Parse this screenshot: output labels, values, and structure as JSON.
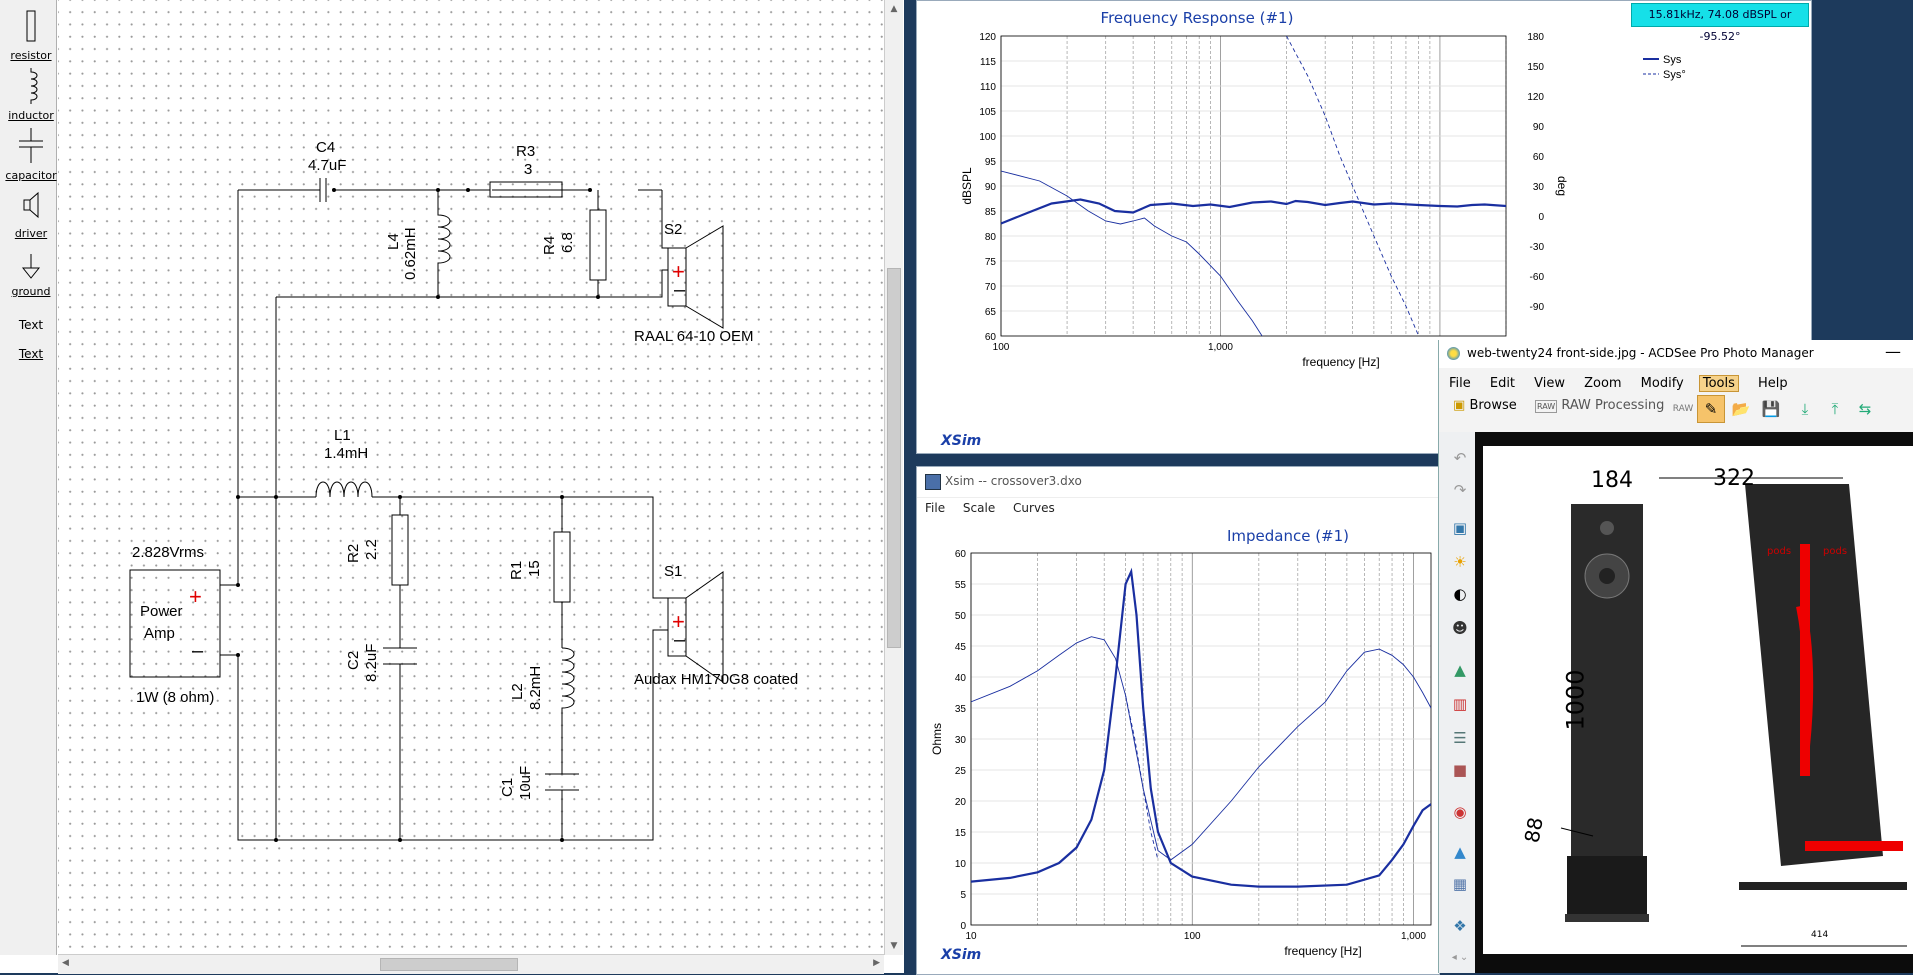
{
  "palette": {
    "items": [
      {
        "label": "resistor",
        "icon": "resistor-icon"
      },
      {
        "label": "inductor",
        "icon": "inductor-icon"
      },
      {
        "label": "capacitor",
        "icon": "capacitor-icon"
      },
      {
        "label": "driver",
        "icon": "driver-icon"
      },
      {
        "label": "ground",
        "icon": "ground-icon"
      },
      {
        "label": "Text",
        "icon": "text-icon"
      },
      {
        "label": "Text",
        "icon": "text-icon"
      }
    ]
  },
  "schematic": {
    "c4_name": "C4",
    "c4_value": "4.7uF",
    "r3_name": "R3",
    "r3_value": "3",
    "l4_name": "L4",
    "l4_value": "0.62mH",
    "r4_name": "R4",
    "r4_value": "6.8",
    "s2_name": "S2",
    "s2_label": "RAAL 64-10 OEM",
    "l1_name": "L1",
    "l1_value": "1.4mH",
    "r2_name": "R2",
    "r2_value": "2.2",
    "c2_name": "C2",
    "c2_value": "8.2uF",
    "r1_name": "R1",
    "r1_value": "15",
    "l2_name": "L2",
    "l2_value": "8.2mH",
    "c1_name": "C1",
    "c1_value": "10uF",
    "s1_name": "S1",
    "s1_label": "Audax HM170G8 coated",
    "amp_voltage": "2.828Vrms",
    "amp_label_1": "Power",
    "amp_label_2": "Amp",
    "amp_power": "1W (8 ohm)"
  },
  "freq_window": {
    "title": "Frequency Response (#1)",
    "readout": "15.81kHz, 74.08 dBSPL or -95.52°",
    "brand": "XSim",
    "xlabel": "frequency [Hz]",
    "ylabel": "dBSPL",
    "y2label": "deg",
    "legend": [
      "Sys",
      "Sys°"
    ]
  },
  "imp_window": {
    "window_title": "Xsim -- crossover3.dxo",
    "menu": [
      "File",
      "Scale",
      "Curves"
    ],
    "title": "Impedance (#1)",
    "brand": "XSim",
    "xlabel": "frequency [Hz]",
    "ylabel": "Ohms"
  },
  "acdsee": {
    "title": "web-twenty24 front-side.jpg - ACDSee Pro Photo Manager",
    "menu": [
      "File",
      "Edit",
      "View",
      "Zoom",
      "Modify",
      "Tools",
      "Help"
    ],
    "active_menu": "Tools",
    "browse_label": "Browse",
    "raw_label": "RAW Processing",
    "photo": {
      "width_front": "184",
      "width_side": "322",
      "height": "1000",
      "base": "88",
      "depth": "414",
      "mark_1": "pods",
      "mark_2": "pods"
    }
  },
  "chart_data": [
    {
      "type": "line",
      "title": "Frequency Response (#1)",
      "xlabel": "frequency [Hz]",
      "ylabel": "dBSPL",
      "y2label": "deg",
      "xscale": "log",
      "xlim": [
        100,
        20000
      ],
      "ylim": [
        60,
        120
      ],
      "y2lim": [
        -120,
        180
      ],
      "x_ticks": [
        "100",
        "1,000"
      ],
      "y_ticks": [
        60,
        65,
        70,
        75,
        80,
        85,
        90,
        95,
        100,
        105,
        110,
        115,
        120
      ],
      "y2_ticks": [
        -90,
        -60,
        -30,
        0,
        30,
        60,
        90,
        120,
        150,
        180
      ],
      "grid": true,
      "legend": "top-right",
      "series": [
        {
          "name": "Sys",
          "axis": "left",
          "style": "solid",
          "x": [
            100,
            130,
            170,
            230,
            280,
            330,
            400,
            480,
            600,
            750,
            900,
            1100,
            1400,
            1700,
            2000,
            2200,
            2500,
            3000,
            3500,
            4000,
            5000,
            6000,
            8000,
            10000,
            12000,
            14000,
            16000,
            20000
          ],
          "y": [
            82.5,
            84.5,
            86.5,
            87.3,
            86.5,
            85.0,
            84.7,
            86.2,
            86.5,
            86.0,
            86.3,
            85.8,
            86.7,
            86.9,
            86.4,
            87.0,
            86.8,
            86.2,
            86.6,
            86.9,
            86.3,
            86.5,
            86.2,
            86.0,
            85.9,
            86.2,
            86.3,
            86.0
          ]
        },
        {
          "name": "Sys°",
          "axis": "right",
          "style": "thin",
          "x": [
            100,
            150,
            200,
            250,
            300,
            350,
            400,
            450,
            500,
            600,
            700,
            800,
            1000,
            1200,
            1400,
            1600,
            1800
          ],
          "y": [
            45,
            35,
            20,
            5,
            -5,
            -8,
            -5,
            -2,
            -10,
            -20,
            -26,
            -38,
            -60,
            -85,
            -105,
            -125,
            -150
          ]
        },
        {
          "name": "Sys°",
          "axis": "right",
          "style": "dashed",
          "x": [
            2000,
            2500,
            3000,
            3500,
            4000,
            5000,
            6000,
            7000,
            8000,
            10000
          ],
          "y": [
            180,
            140,
            100,
            60,
            30,
            -20,
            -60,
            -90,
            -120,
            -150
          ]
        }
      ]
    },
    {
      "type": "line",
      "title": "Impedance (#1)",
      "xlabel": "frequency [Hz]",
      "ylabel": "Ohms",
      "xscale": "log",
      "xlim": [
        10,
        1200
      ],
      "ylim": [
        0,
        60
      ],
      "x_ticks": [
        "10",
        "100",
        "1,000"
      ],
      "y_ticks": [
        0,
        5,
        10,
        15,
        20,
        25,
        30,
        35,
        40,
        45,
        50,
        55,
        60
      ],
      "grid": true,
      "series": [
        {
          "style": "thick",
          "x": [
            10,
            15,
            20,
            25,
            30,
            35,
            40,
            45,
            50,
            53,
            56,
            60,
            65,
            70,
            80,
            100,
            150,
            200,
            300,
            500,
            700,
            800,
            900,
            1000,
            1100,
            1200
          ],
          "y": [
            7,
            7.6,
            8.5,
            10,
            12.5,
            17,
            25,
            40,
            55,
            57,
            50,
            35,
            22,
            15,
            10,
            7.8,
            6.5,
            6.2,
            6.2,
            6.5,
            8,
            10.5,
            13,
            16,
            18.5,
            19.5
          ]
        },
        {
          "style": "thin",
          "x": [
            10,
            15,
            20,
            25,
            30,
            35,
            40,
            45,
            50,
            60,
            70,
            80,
            100,
            150,
            200,
            300,
            400,
            500,
            600,
            700,
            800,
            900,
            1000,
            1100,
            1200
          ],
          "y": [
            36,
            38.5,
            41,
            43.5,
            45.5,
            46.5,
            46,
            43,
            37,
            22,
            12,
            10.5,
            13,
            20,
            25.5,
            32,
            36,
            41,
            44,
            44.5,
            43.5,
            42,
            40,
            37.5,
            35
          ]
        },
        {
          "style": "dashed",
          "x": [
            50,
            55,
            60,
            65,
            70
          ],
          "y": [
            37,
            30,
            22,
            15,
            10.5
          ]
        }
      ]
    }
  ]
}
